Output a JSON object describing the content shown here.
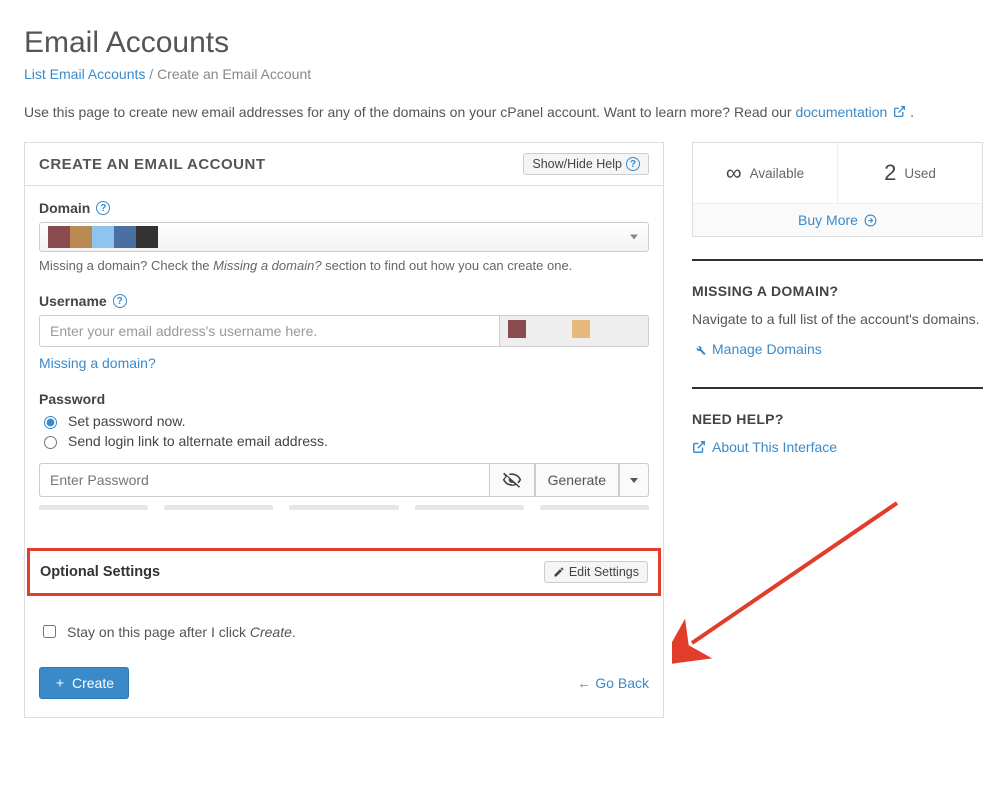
{
  "page": {
    "title": "Email Accounts",
    "breadcrumb_link": "List Email Accounts",
    "breadcrumb_sep": " / ",
    "breadcrumb_current": "Create an Email Account",
    "intro_a": "Use this page to create new email addresses for any of the domains on your cPanel account. Want to learn more? Read our ",
    "intro_link": "documentation",
    "intro_b": " ."
  },
  "panel": {
    "title": "CREATE AN EMAIL ACCOUNT",
    "showhide": "Show/Hide Help"
  },
  "domain": {
    "label": "Domain",
    "hint_a": "Missing a domain? Check the ",
    "hint_em": "Missing a domain?",
    "hint_b": " section to find out how you can create one."
  },
  "username": {
    "label": "Username",
    "placeholder": "Enter your email address's username here.",
    "missing_link": "Missing a domain?"
  },
  "password": {
    "label": "Password",
    "opt_now": "Set password now.",
    "opt_send": "Send login link to alternate email address.",
    "placeholder": "Enter Password",
    "generate": "Generate"
  },
  "optional": {
    "title": "Optional Settings",
    "edit": "Edit Settings"
  },
  "footer": {
    "stay_a": "Stay on this page after I click ",
    "stay_em": "Create",
    "stay_b": ".",
    "create": "Create",
    "goback": "Go Back"
  },
  "side": {
    "available_label": "Available",
    "used_value": "2",
    "used_label": "Used",
    "buy_more": "Buy More",
    "missing_title": "MISSING A DOMAIN?",
    "missing_text": "Navigate to a full list of the account's domains.",
    "manage_domains": "Manage Domains",
    "need_help": "NEED HELP?",
    "about": "About This Interface"
  }
}
